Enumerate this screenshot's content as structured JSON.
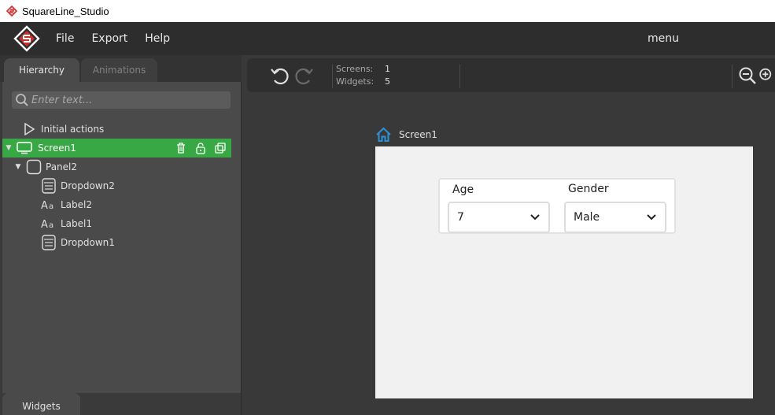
{
  "window": {
    "title": "SquareLine_Studio"
  },
  "menubar": {
    "items": [
      "File",
      "Export",
      "Help"
    ],
    "right_label": "menu"
  },
  "left_panel": {
    "tabs": [
      "Hierarchy",
      "Animations"
    ],
    "search_placeholder": "Enter text...",
    "tree": [
      {
        "label": "Initial actions",
        "icon": "play-icon"
      },
      {
        "label": "Screen1",
        "icon": "screen-icon",
        "selected": true
      },
      {
        "label": "Panel2",
        "icon": "panel-icon"
      },
      {
        "label": "Dropdown2",
        "icon": "dropdown-icon"
      },
      {
        "label": "Label2",
        "icon": "label-icon"
      },
      {
        "label": "Label1",
        "icon": "label-icon"
      },
      {
        "label": "Dropdown1",
        "icon": "dropdown-icon"
      }
    ],
    "bottom_tab": "Widgets"
  },
  "toolbar": {
    "screens_label": "Screens:",
    "screens_value": "1",
    "widgets_label": "Widgets:",
    "widgets_value": "5"
  },
  "canvas": {
    "breadcrumb": "Screen1",
    "panel": {
      "age_label": "Age",
      "age_value": "7",
      "gender_label": "Gender",
      "gender_value": "Male"
    }
  },
  "colors": {
    "accent": "#38a845",
    "home_icon": "#2f8fd8",
    "menubar": "#2d2d2d"
  }
}
